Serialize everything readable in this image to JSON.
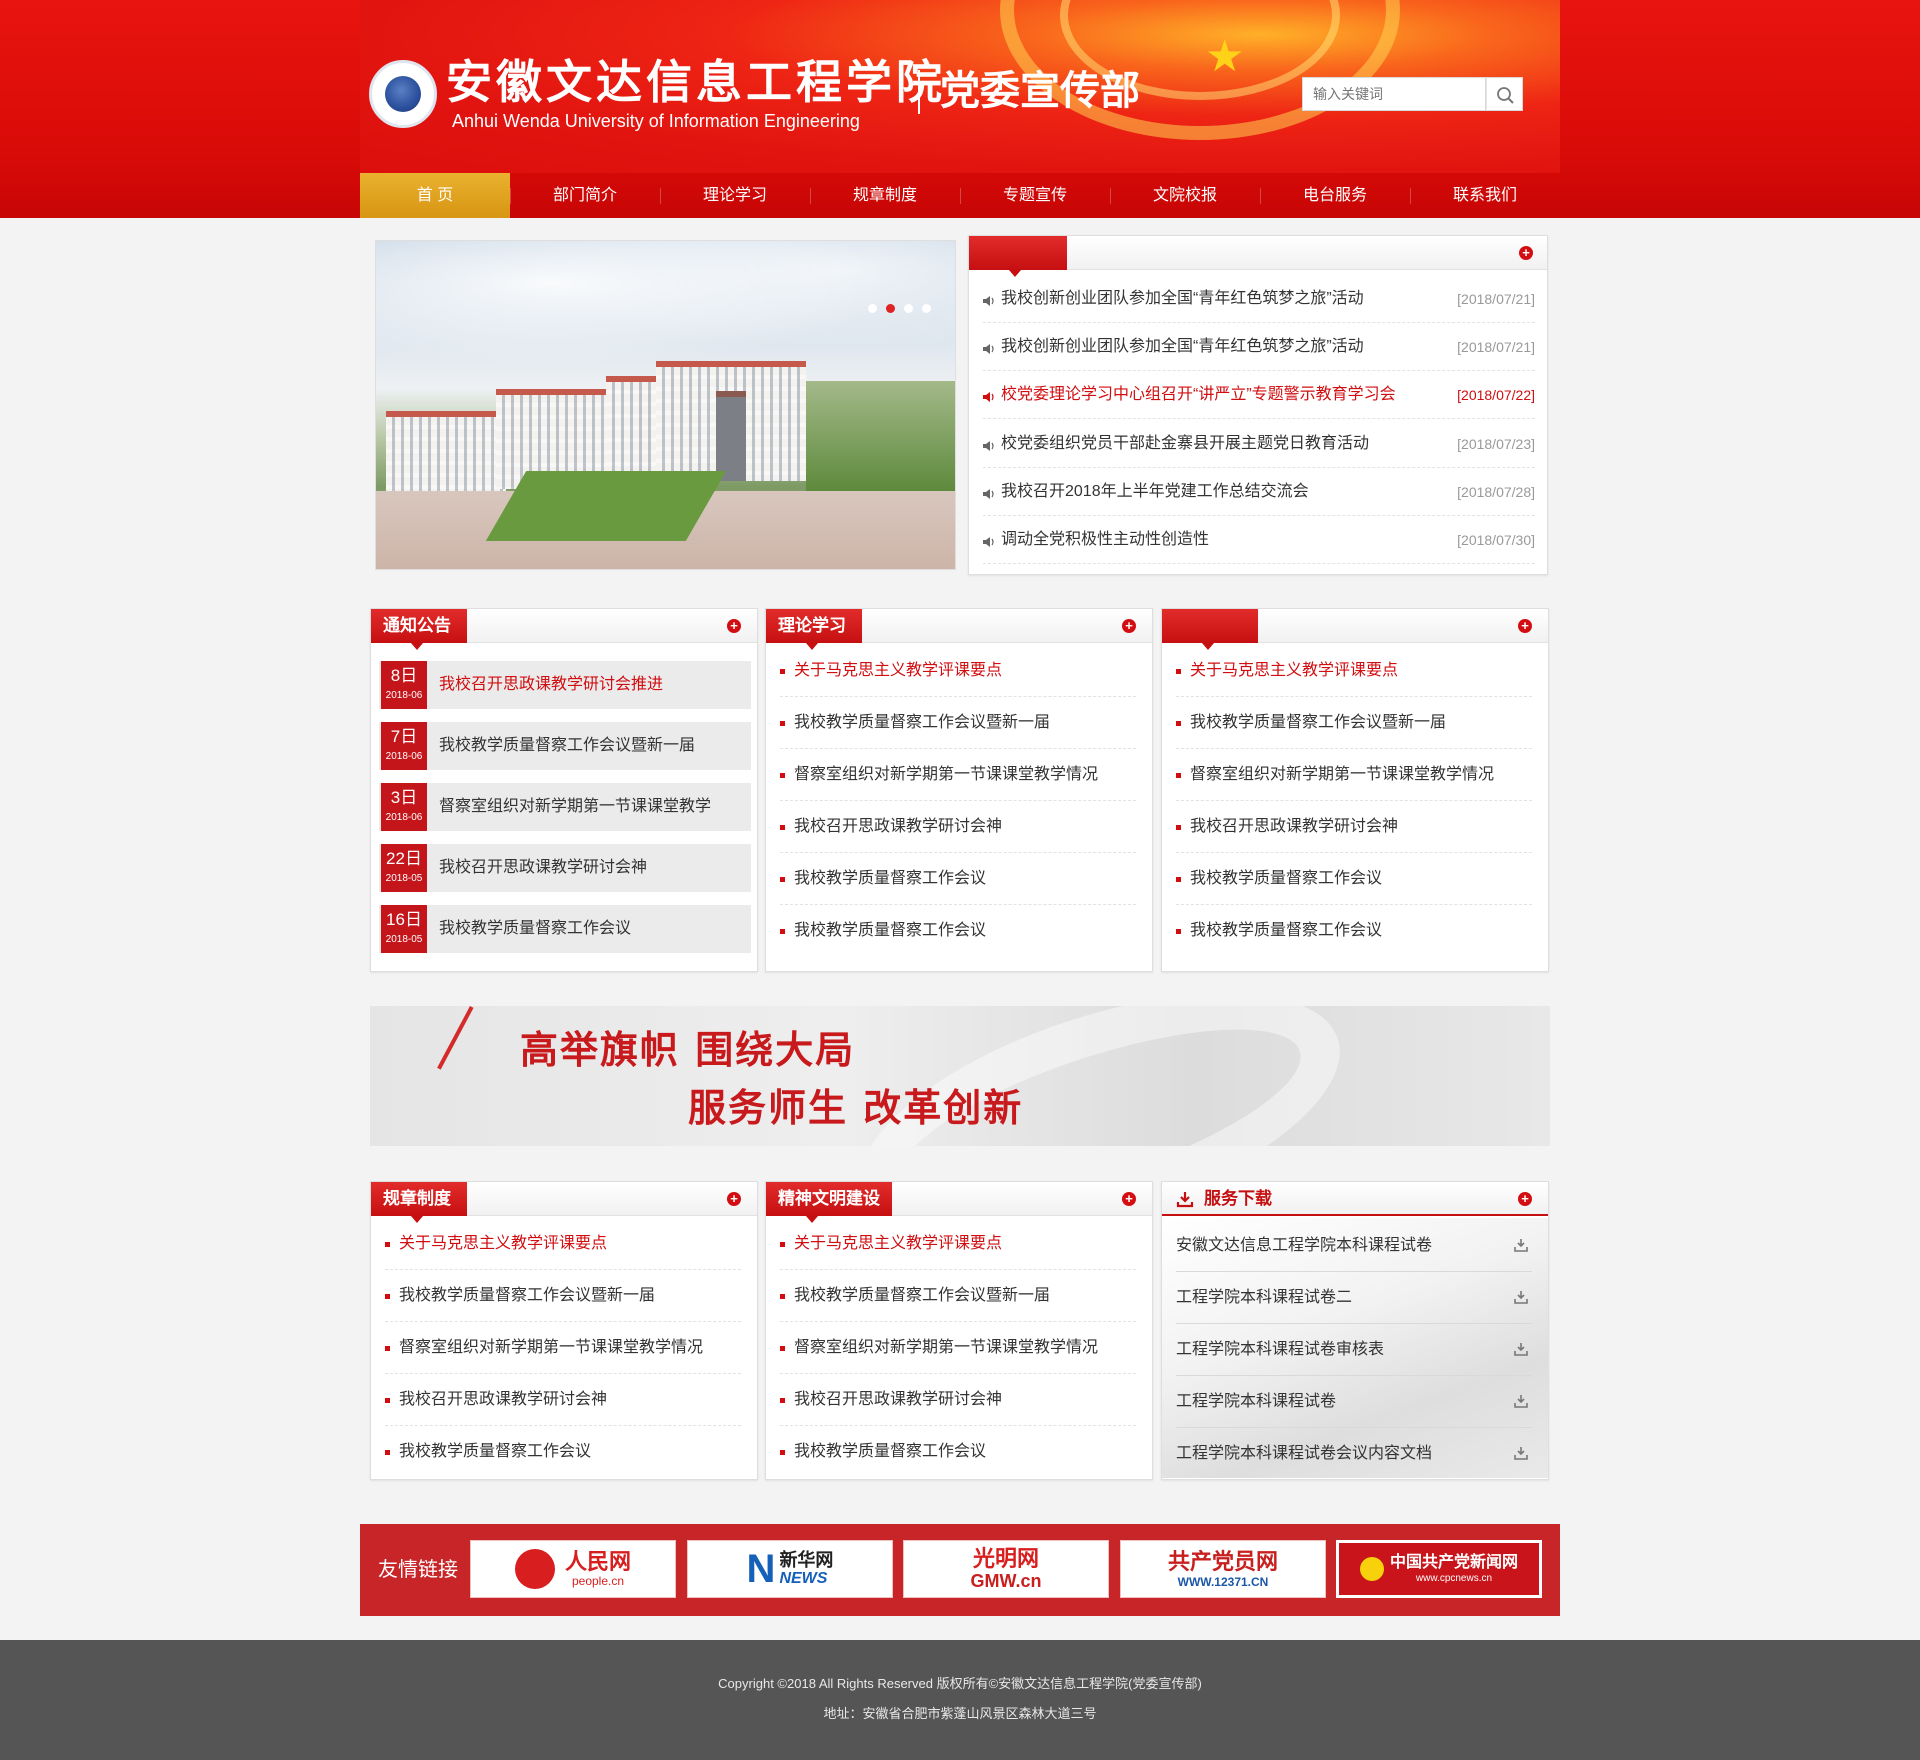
{
  "header": {
    "college_cn": "安徽文达信息工程学院",
    "college_en": "Anhui Wenda University of Information Engineering",
    "dept_title": "党委宣传部",
    "search_placeholder": "输入关键词",
    "colors": {
      "primary": "#d90b08",
      "nav_active": "#d79512",
      "accent_red": "#c60f10"
    }
  },
  "nav": {
    "items": [
      "首 页",
      "部门简介",
      "理论学习",
      "规章制度",
      "专题宣传",
      "文院校报",
      "电台服务",
      "联系我们"
    ],
    "active_index": 0
  },
  "slider": {
    "dots": 4,
    "active_dot": 1
  },
  "news": {
    "items": [
      {
        "title": "我校创新创业团队参加全国“青年红色筑梦之旅”活动",
        "date": "[2018/07/21]",
        "highlight": false
      },
      {
        "title": "我校创新创业团队参加全国“青年红色筑梦之旅”活动",
        "date": "[2018/07/21]",
        "highlight": false
      },
      {
        "title": "校党委理论学习中心组召开“讲严立”专题警示教育学习会",
        "date": "[2018/07/22]",
        "highlight": true
      },
      {
        "title": "校党委组织党员干部赴金寨县开展主题党日教育活动",
        "date": "[2018/07/23]",
        "highlight": false
      },
      {
        "title": "我校召开2018年上半年党建工作总结交流会",
        "date": "[2018/07/28]",
        "highlight": false
      },
      {
        "title": "调动全党积极性主动性创造性",
        "date": "[2018/07/30]",
        "highlight": false
      }
    ]
  },
  "notice": {
    "title": "通知公告",
    "items": [
      {
        "day": "8日",
        "ym": "2018-06",
        "text": "我校召开思政课教学研讨会推进",
        "highlight": true
      },
      {
        "day": "7日",
        "ym": "2018-06",
        "text": "我校教学质量督察工作会议暨新一届",
        "highlight": false
      },
      {
        "day": "3日",
        "ym": "2018-06",
        "text": "督察室组织对新学期第一节课课堂教学",
        "highlight": false
      },
      {
        "day": "22日",
        "ym": "2018-05",
        "text": "我校召开思政课教学研讨会神",
        "highlight": false
      },
      {
        "day": "16日",
        "ym": "2018-05",
        "text": "我校教学质量督察工作会议",
        "highlight": false
      }
    ]
  },
  "theory": {
    "title": "理论学习",
    "items": [
      "关于马克思主义教学评课要点",
      "我校教学质量督察工作会议暨新一届",
      "督察室组织对新学期第一节课课堂教学情况",
      "我校召开思政课教学研讨会神",
      "我校教学质量督察工作会议",
      "我校教学质量督察工作会议"
    ]
  },
  "third_box": {
    "title": "",
    "items": [
      "关于马克思主义教学评课要点",
      "我校教学质量督察工作会议暨新一届",
      "督察室组织对新学期第一节课课堂教学情况",
      "我校召开思政课教学研讨会神",
      "我校教学质量督察工作会议",
      "我校教学质量督察工作会议"
    ]
  },
  "banner": {
    "line1": "高举旗帜 围绕大局",
    "line2": "服务师生 改革创新"
  },
  "rules": {
    "title": "规章制度",
    "items": [
      "关于马克思主义教学评课要点",
      "我校教学质量督察工作会议暨新一届",
      "督察室组织对新学期第一节课课堂教学情况",
      "我校召开思政课教学研讨会神",
      "我校教学质量督察工作会议"
    ]
  },
  "spirit": {
    "title": "精神文明建设",
    "items": [
      "关于马克思主义教学评课要点",
      "我校教学质量督察工作会议暨新一届",
      "督察室组织对新学期第一节课课堂教学情况",
      "我校召开思政课教学研讨会神",
      "我校教学质量督察工作会议"
    ]
  },
  "downloads": {
    "title": "服务下载",
    "items": [
      "安徽文达信息工程学院本科课程试卷",
      "工程学院本科课程试卷二",
      "工程学院本科课程试卷审核表",
      "工程学院本科课程试卷",
      "工程学院本科课程试卷会议内容文档"
    ]
  },
  "links": {
    "label": "友情链接",
    "items": [
      {
        "name": "人民网",
        "sub": "people.cn"
      },
      {
        "name": "新华网",
        "sub": "NEWS"
      },
      {
        "name": "光明网",
        "sub": "GMW.cn"
      },
      {
        "name": "共产党员网",
        "sub": "WWW.12371.CN"
      },
      {
        "name": "中国共产党新闻网",
        "sub": "www.cpcnews.cn"
      }
    ]
  },
  "footer": {
    "copyright": "Copyright ©2018 All Rights Reserved 版权所有©安徽文达信息工程学院(党委宣传部)",
    "address": "地址：安徽省合肥市紫蓬山风景区森林大道三号"
  }
}
